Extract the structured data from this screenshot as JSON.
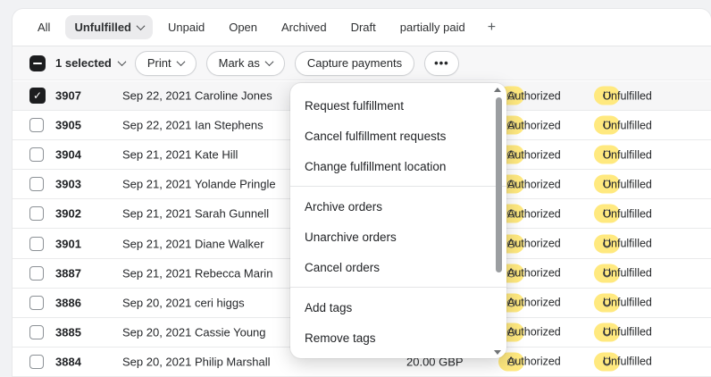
{
  "tabs": {
    "items": [
      {
        "label": "All"
      },
      {
        "label": "Unfulfilled",
        "selected": true
      },
      {
        "label": "Unpaid"
      },
      {
        "label": "Open"
      },
      {
        "label": "Archived"
      },
      {
        "label": "Draft"
      },
      {
        "label": "partially paid"
      },
      {
        "label": "+"
      }
    ]
  },
  "bulk": {
    "selected_label": "1 selected",
    "print": "Print",
    "mark_as": "Mark as",
    "capture": "Capture payments",
    "more": "•••"
  },
  "menu": {
    "sections": [
      {
        "items": [
          "Request fulfillment",
          "Cancel fulfillment requests",
          "Change fulfillment location"
        ]
      },
      {
        "items": [
          "Archive orders",
          "Unarchive orders",
          "Cancel orders"
        ]
      },
      {
        "items": [
          "Add tags",
          "Remove tags"
        ]
      }
    ]
  },
  "orders": [
    {
      "number": "3907",
      "date": "Sep 22, 2021",
      "customer": "Caroline Jones",
      "total": "",
      "payment_status": "Authorized",
      "fulfillment_status": "Unfulfilled",
      "checked": true
    },
    {
      "number": "3905",
      "date": "Sep 22, 2021",
      "customer": "Ian Stephens",
      "total": "",
      "payment_status": "Authorized",
      "fulfillment_status": "Unfulfilled",
      "checked": false
    },
    {
      "number": "3904",
      "date": "Sep 21, 2021",
      "customer": "Kate Hill",
      "total": "",
      "payment_status": "Authorized",
      "fulfillment_status": "Unfulfilled",
      "checked": false
    },
    {
      "number": "3903",
      "date": "Sep 21, 2021",
      "customer": "Yolande Pringle",
      "total": "",
      "payment_status": "Authorized",
      "fulfillment_status": "Unfulfilled",
      "checked": false
    },
    {
      "number": "3902",
      "date": "Sep 21, 2021",
      "customer": "Sarah Gunnell",
      "total": "",
      "payment_status": "Authorized",
      "fulfillment_status": "Unfulfilled",
      "checked": false
    },
    {
      "number": "3901",
      "date": "Sep 21, 2021",
      "customer": "Diane Walker",
      "total": "",
      "payment_status": "Authorized",
      "fulfillment_status": "Unfulfilled",
      "checked": false
    },
    {
      "number": "3887",
      "date": "Sep 21, 2021",
      "customer": "Rebecca Marin",
      "total": "",
      "payment_status": "Authorized",
      "fulfillment_status": "Unfulfilled",
      "checked": false
    },
    {
      "number": "3886",
      "date": "Sep 20, 2021",
      "customer": "ceri higgs",
      "total": "",
      "payment_status": "Authorized",
      "fulfillment_status": "Unfulfilled",
      "checked": false
    },
    {
      "number": "3885",
      "date": "Sep 20, 2021",
      "customer": "Cassie Young",
      "total": "",
      "payment_status": "Authorized",
      "fulfillment_status": "Unfulfilled",
      "checked": false
    },
    {
      "number": "3884",
      "date": "Sep 20, 2021",
      "customer": "Philip Marshall",
      "total": "20.00 GBP",
      "payment_status": "Authorized",
      "fulfillment_status": "Unfulfilled",
      "checked": false
    }
  ],
  "colors": {
    "badge_bg": "#ffe97f",
    "selection_dark": "#1c1d1f",
    "page_bg": "#f1f2f4"
  }
}
